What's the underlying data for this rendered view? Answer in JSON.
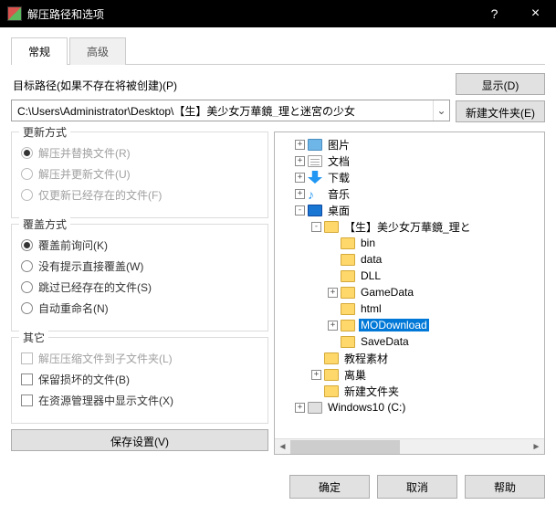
{
  "window": {
    "title": "解压路径和选项",
    "help": "?",
    "close": "×"
  },
  "tabs": {
    "general": "常规",
    "advanced": "高级"
  },
  "path_label": "目标路径(如果不存在将被创建)(P)",
  "path_value": "C:\\Users\\Administrator\\Desktop\\【生】美少女万華鏡_理と迷宮の少女",
  "buttons": {
    "display": "显示(D)",
    "new_folder": "新建文件夹(E)",
    "save_settings": "保存设置(V)",
    "ok": "确定",
    "cancel": "取消",
    "help": "帮助"
  },
  "groups": {
    "update": {
      "title": "更新方式",
      "opts": [
        "解压并替换文件(R)",
        "解压并更新文件(U)",
        "仅更新已经存在的文件(F)"
      ]
    },
    "overwrite": {
      "title": "覆盖方式",
      "opts": [
        "覆盖前询问(K)",
        "没有提示直接覆盖(W)",
        "跳过已经存在的文件(S)",
        "自动重命名(N)"
      ]
    },
    "misc": {
      "title": "其它",
      "opts": [
        "解压压缩文件到子文件夹(L)",
        "保留损坏的文件(B)",
        "在资源管理器中显示文件(X)"
      ]
    }
  },
  "tree": [
    {
      "depth": 0,
      "exp": "+",
      "icon": "pic",
      "label": "图片"
    },
    {
      "depth": 0,
      "exp": "+",
      "icon": "doc",
      "label": "文档"
    },
    {
      "depth": 0,
      "exp": "+",
      "icon": "down",
      "label": "下载"
    },
    {
      "depth": 0,
      "exp": "+",
      "icon": "music",
      "label": "音乐"
    },
    {
      "depth": 0,
      "exp": "-",
      "icon": "desktop",
      "label": "桌面"
    },
    {
      "depth": 1,
      "exp": "-",
      "icon": "folder",
      "label": "【生】美少女万華鏡_理と"
    },
    {
      "depth": 2,
      "exp": "",
      "icon": "folder",
      "label": "bin"
    },
    {
      "depth": 2,
      "exp": "",
      "icon": "folder",
      "label": "data"
    },
    {
      "depth": 2,
      "exp": "",
      "icon": "folder",
      "label": "DLL"
    },
    {
      "depth": 2,
      "exp": "+",
      "icon": "folder",
      "label": "GameData"
    },
    {
      "depth": 2,
      "exp": "",
      "icon": "folder",
      "label": "html"
    },
    {
      "depth": 2,
      "exp": "+",
      "icon": "folder",
      "label": "MODownload",
      "selected": true
    },
    {
      "depth": 2,
      "exp": "",
      "icon": "folder",
      "label": "SaveData"
    },
    {
      "depth": 1,
      "exp": "",
      "icon": "folder",
      "label": "教程素材"
    },
    {
      "depth": 1,
      "exp": "+",
      "icon": "folder",
      "label": "离巢"
    },
    {
      "depth": 1,
      "exp": "",
      "icon": "folder",
      "label": "新建文件夹"
    },
    {
      "depth": 0,
      "exp": "+",
      "icon": "drive",
      "label": "Windows10 (C:)"
    }
  ]
}
